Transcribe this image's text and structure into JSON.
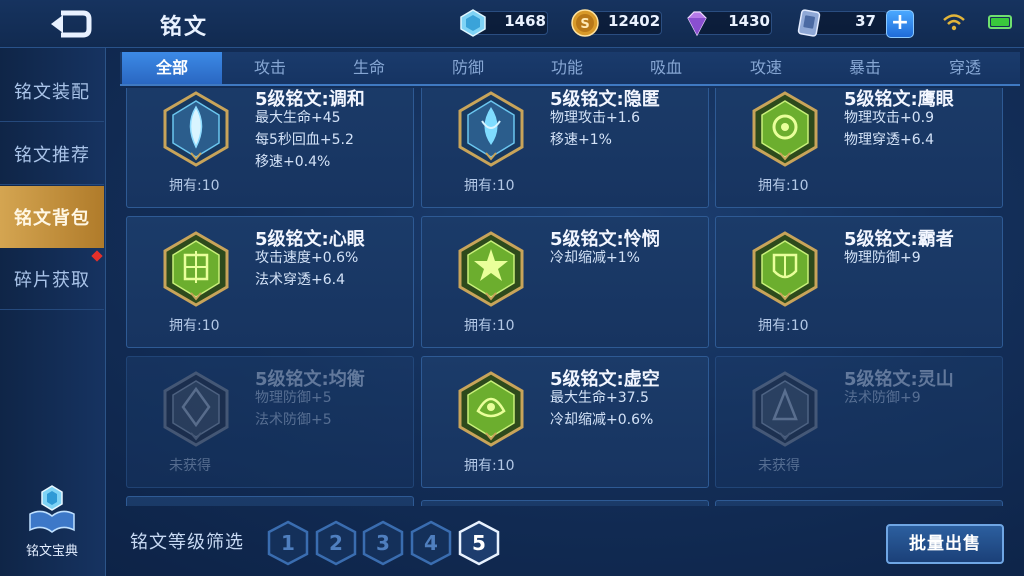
{
  "header": {
    "back_icon": "back-arrow-icon",
    "title": "铭文",
    "resources": [
      {
        "icon": "crystal-icon",
        "value": "1468"
      },
      {
        "icon": "gold-coin-icon",
        "value": "12402"
      },
      {
        "icon": "diamond-icon",
        "value": "1430"
      },
      {
        "icon": "voucher-card-icon",
        "value": "37"
      }
    ],
    "plus_label": "+"
  },
  "sidebar": {
    "items": [
      {
        "label": "铭文装配"
      },
      {
        "label": "铭文推荐"
      },
      {
        "label": "铭文背包"
      },
      {
        "label": "碎片获取"
      }
    ],
    "active_index": 2,
    "codex_label": "铭文宝典"
  },
  "tabs": [
    "全部",
    "攻击",
    "生命",
    "防御",
    "功能",
    "吸血",
    "攻速",
    "暴击",
    "穿透"
  ],
  "active_tab": 0,
  "cards": [
    {
      "name": "5级铭文:调和",
      "stats": [
        "最大生命+45",
        "每5秒回血+5.2",
        "移速+0.4%"
      ],
      "owned": "拥有:10",
      "color": "blue"
    },
    {
      "name": "5级铭文:隐匿",
      "stats": [
        "物理攻击+1.6",
        "移速+1%"
      ],
      "owned": "拥有:10",
      "color": "blue"
    },
    {
      "name": "5级铭文:鹰眼",
      "stats": [
        "物理攻击+0.9",
        "物理穿透+6.4"
      ],
      "owned": "拥有:10",
      "color": "green"
    },
    {
      "name": "5级铭文:心眼",
      "stats": [
        "攻击速度+0.6%",
        "法术穿透+6.4"
      ],
      "owned": "拥有:10",
      "color": "green"
    },
    {
      "name": "5级铭文:怜悯",
      "stats": [
        "冷却缩减+1%"
      ],
      "owned": "拥有:10",
      "color": "green"
    },
    {
      "name": "5级铭文:霸者",
      "stats": [
        "物理防御+9"
      ],
      "owned": "拥有:10",
      "color": "green"
    },
    {
      "name": "5级铭文:均衡",
      "stats": [
        "物理防御+5",
        "法术防御+5"
      ],
      "owned": "未获得",
      "color": "gray"
    },
    {
      "name": "5级铭文:虚空",
      "stats": [
        "最大生命+37.5",
        "冷却缩减+0.6%"
      ],
      "owned": "拥有:10",
      "color": "green"
    },
    {
      "name": "5级铭文:灵山",
      "stats": [
        "法术防御+9"
      ],
      "owned": "未获得",
      "color": "gray"
    }
  ],
  "filter": {
    "label": "铭文等级筛选",
    "levels": [
      "1",
      "2",
      "3",
      "4",
      "5"
    ],
    "active_level": "5"
  },
  "sell_button": "批量出售",
  "colors": {
    "accent_gold": "#d4a551",
    "accent_blue": "#3c8ae6",
    "rune_green": "#7fc63a",
    "rune_blue": "#5ac8f2"
  }
}
